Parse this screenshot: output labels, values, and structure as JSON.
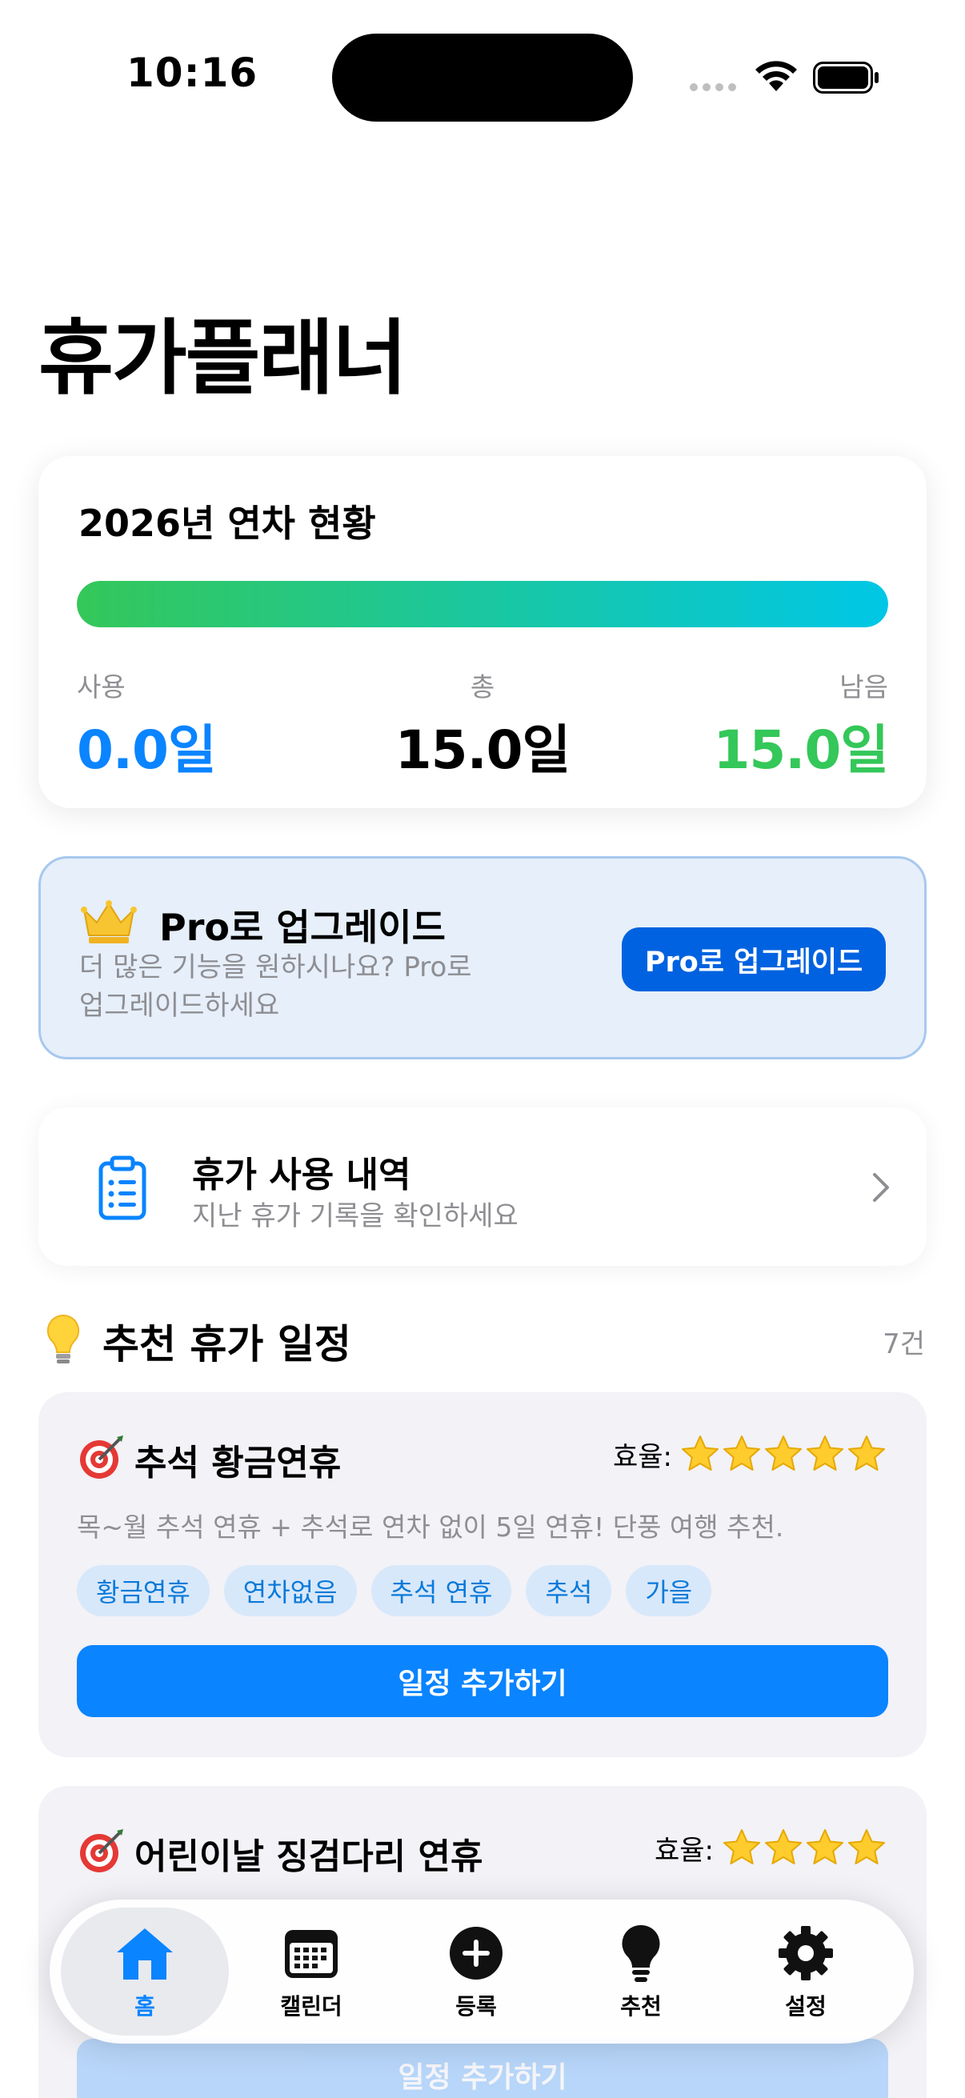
{
  "status_bar": {
    "time": "10:16"
  },
  "page_title": "휴가플래너",
  "summary": {
    "title": "2026년 연차 현황",
    "progress_fraction": 1.0,
    "used_label": "사용",
    "used_value": "0.0일",
    "total_label": "총",
    "total_value": "15.0일",
    "remaining_label": "남음",
    "remaining_value": "15.0일"
  },
  "pro": {
    "icon": "crown-icon",
    "title": "Pro로 업그레이드",
    "description": "더 많은 기능을 원하시나요? Pro로 업그레이드하세요",
    "button_label": "Pro로 업그레이드"
  },
  "history": {
    "icon": "clipboard-icon",
    "title": "휴가 사용 내역",
    "subtitle": "지난 휴가 기록을 확인하세요"
  },
  "recommendations": {
    "icon": "lightbulb-icon",
    "section_title": "추천 휴가 일정",
    "count": "7건",
    "items": [
      {
        "title": "추석 황금연휴",
        "efficiency_label": "효율:",
        "rating": 5,
        "description": "목~월 추석 연휴 + 추석로 연차 없이 5일 연휴! 단풍 여행 추천.",
        "tags": [
          "황금연휴",
          "연차없음",
          "추석 연휴",
          "추석",
          "가을"
        ],
        "button_label": "일정 추가하기"
      },
      {
        "title": "어린이날 징검다리 연휴",
        "efficiency_label": "효율:",
        "rating": 4,
        "button_label": "일정 추가하기"
      }
    ]
  },
  "tab_bar": {
    "tabs": [
      {
        "label": "홈",
        "icon": "house-icon",
        "active": true
      },
      {
        "label": "캘린더",
        "icon": "calendar-icon",
        "active": false
      },
      {
        "label": "등록",
        "icon": "plus-circle-icon",
        "active": false
      },
      {
        "label": "추천",
        "icon": "lightbulb-icon",
        "active": false
      },
      {
        "label": "설정",
        "icon": "gear-icon",
        "active": false
      }
    ]
  },
  "colors": {
    "accent": "#0a84ff",
    "success": "#34c759",
    "progress_end": "#00c7e6",
    "pro_button": "#0062e0"
  }
}
